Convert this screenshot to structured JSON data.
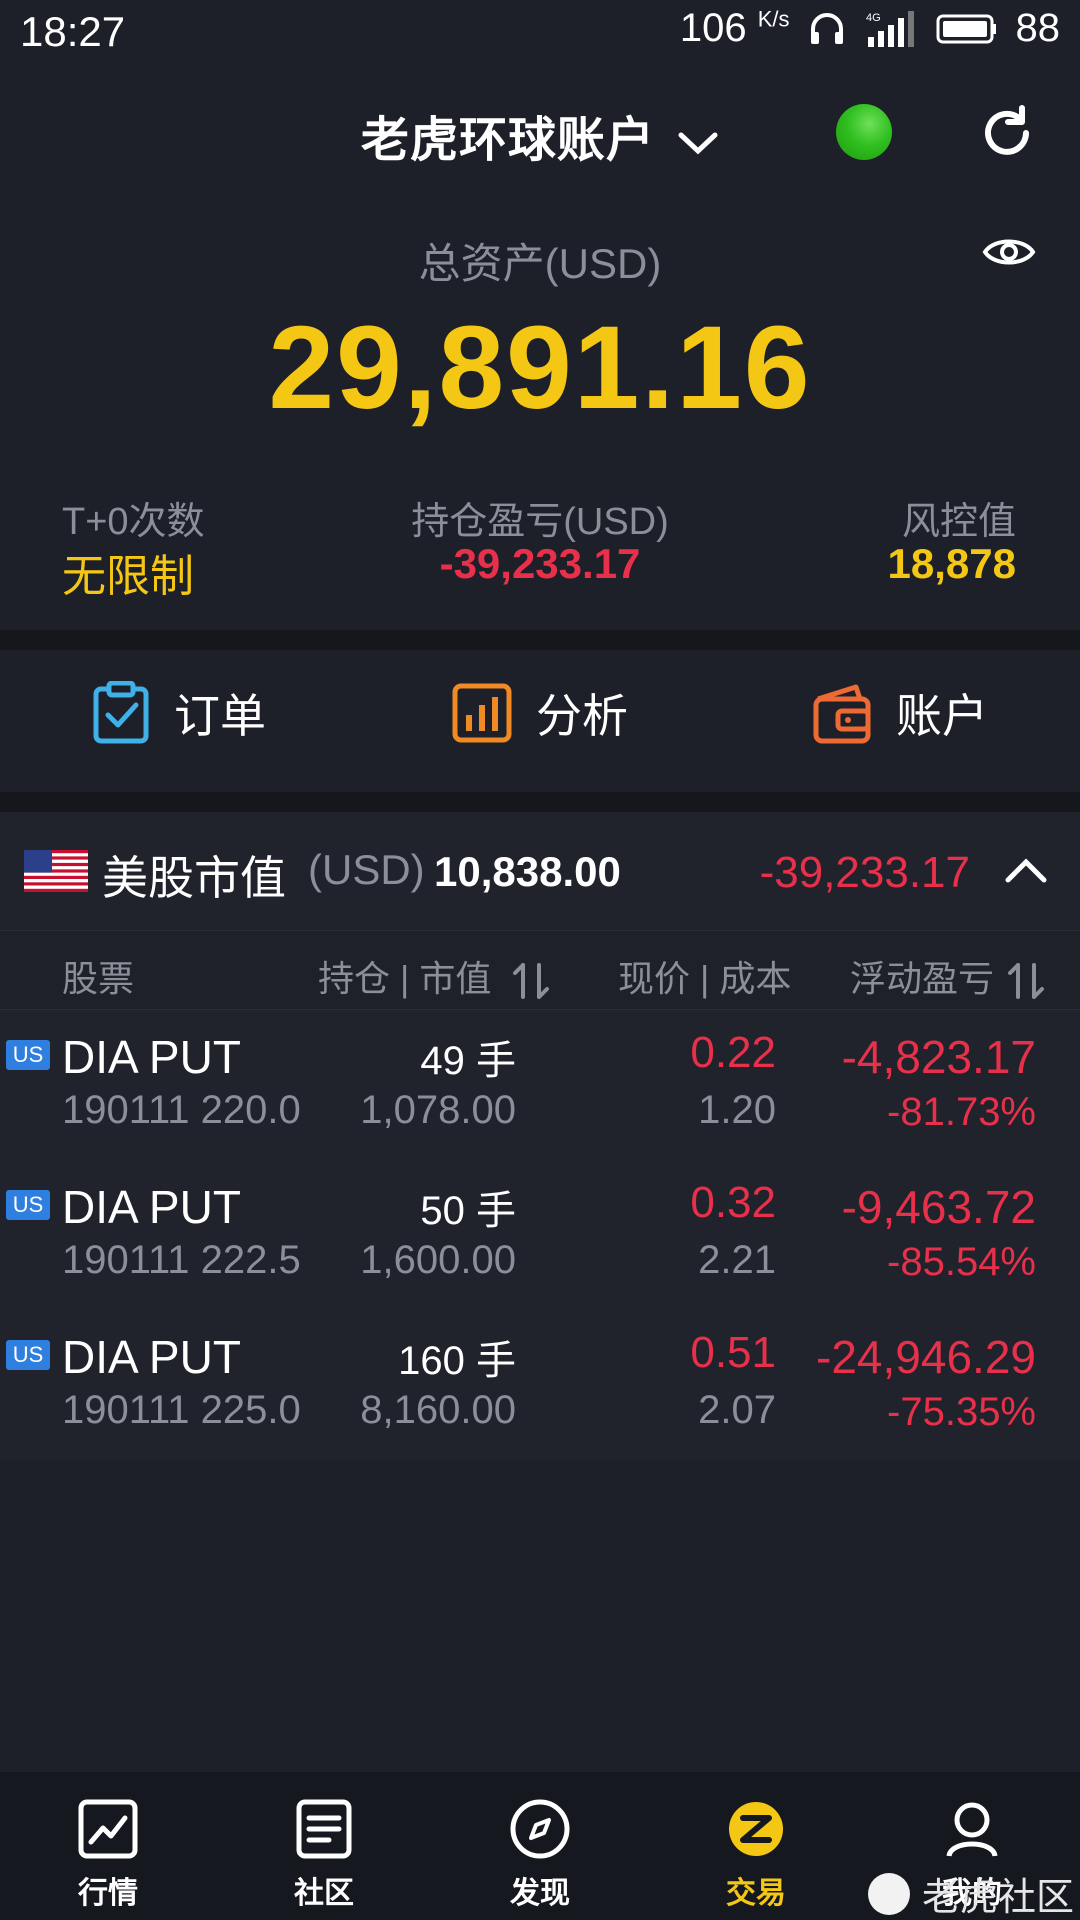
{
  "status_bar": {
    "time": "18:27",
    "speed": "106",
    "speed_unit": "K/s",
    "network": "4G",
    "battery": "88"
  },
  "header": {
    "account_title": "老虎环球账户"
  },
  "summary": {
    "total_label": "总资产(USD)",
    "total_value": "29,891.16",
    "t0_label": "T+0次数",
    "t0_value": "无限制",
    "pnl_label": "持仓盈亏(USD)",
    "pnl_value": "-39,233.17",
    "risk_label": "风控值",
    "risk_value": "18,878"
  },
  "actions": {
    "orders": "订单",
    "analysis": "分析",
    "account": "账户"
  },
  "market": {
    "title": "美股市值",
    "unit": "(USD)",
    "value": "10,838.00",
    "pnl": "-39,233.17"
  },
  "columns": {
    "stock": "股票",
    "position": "持仓 | 市值",
    "price": "现价 | 成本",
    "float_pnl": "浮动盈亏"
  },
  "positions": [
    {
      "badge": "US",
      "name": "DIA PUT",
      "contract": "190111 220.0",
      "qty": "49 手",
      "market_value": "1,078.00",
      "price": "0.22",
      "cost": "1.20",
      "pnl": "-4,823.17",
      "pnl_pct": "-81.73%"
    },
    {
      "badge": "US",
      "name": "DIA PUT",
      "contract": "190111 222.5",
      "qty": "50 手",
      "market_value": "1,600.00",
      "price": "0.32",
      "cost": "2.21",
      "pnl": "-9,463.72",
      "pnl_pct": "-85.54%"
    },
    {
      "badge": "US",
      "name": "DIA PUT",
      "contract": "190111 225.0",
      "qty": "160 手",
      "market_value": "8,160.00",
      "price": "0.51",
      "cost": "2.07",
      "pnl": "-24,946.29",
      "pnl_pct": "-75.35%"
    }
  ],
  "bottom_nav": {
    "market": "行情",
    "community": "社区",
    "discover": "发现",
    "trade": "交易",
    "me": "我的"
  },
  "watermark": "老虎社区",
  "colors": {
    "accent": "#f5c715",
    "loss": "#e8304a",
    "background": "#1d2028"
  }
}
